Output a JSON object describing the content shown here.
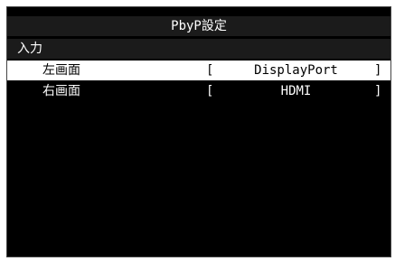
{
  "osd": {
    "title": "PbyP設定",
    "section": "入力",
    "rows": [
      {
        "label": "左画面",
        "bracket_left": "[",
        "value": "DisplayPort",
        "bracket_right": "]",
        "selected": true
      },
      {
        "label": "右画面",
        "bracket_left": "[",
        "value": "HDMI",
        "bracket_right": "]",
        "selected": false
      }
    ]
  },
  "colors": {
    "background": "#000000",
    "bar": "#1b1b1b",
    "text": "#ffffff",
    "selected_bg": "#ffffff",
    "selected_text": "#000000"
  }
}
